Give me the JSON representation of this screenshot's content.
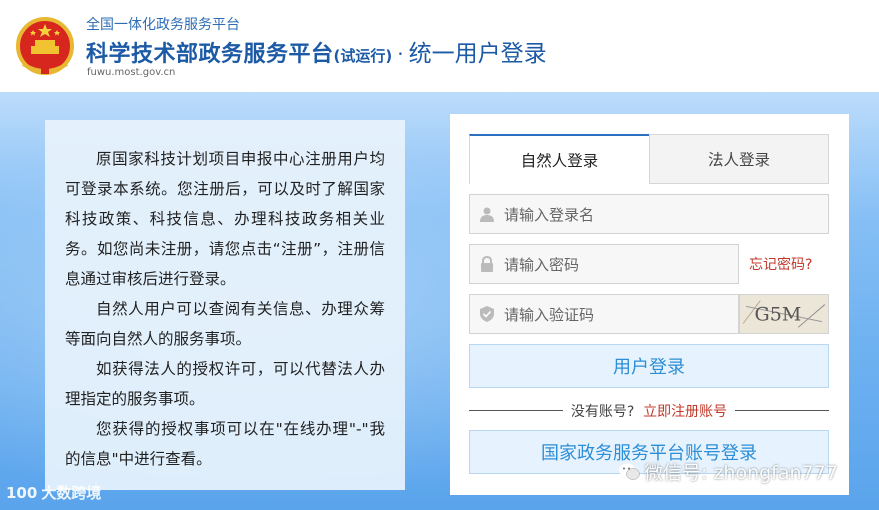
{
  "header": {
    "platform_sub": "全国一体化政务服务平台",
    "title_main": "科学技术部政务服务平台",
    "title_trial": "(试运行)",
    "title_dot": "·",
    "title_login": "统一用户登录",
    "domain": "fuwu.most.gov.cn"
  },
  "info": {
    "paragraphs": [
      "原国家科技计划项目申报中心注册用户均可登录本系统。您注册后，可以及时了解国家科技政策、科技信息、办理科技政务相关业务。如您尚未注册，请您点击“注册”，注册信息通过审核后进行登录。",
      "自然人用户可以查阅有关信息、办理众筹等面向自然人的服务事项。",
      "如获得法人的授权许可，可以代替法人办理指定的服务事项。",
      "您获得的授权事项可以在\"在线办理\"-\"我的信息\"中进行查看。"
    ]
  },
  "login": {
    "tabs": [
      "自然人登录",
      "法人登录"
    ],
    "username_placeholder": "请输入登录名",
    "password_placeholder": "请输入密码",
    "forgot_label": "忘记密码?",
    "captcha_placeholder": "请输入验证码",
    "captcha_text": "G5M",
    "login_button": "用户登录",
    "no_account": "没有账号?",
    "register_now": "立即注册账号",
    "gov_login_button": "国家政务服务平台账号登录"
  },
  "watermarks": {
    "left": "大数跨境",
    "left_badge": "100",
    "right": "微信号: zhongfan777"
  },
  "colors": {
    "title_blue": "#1c5aa6",
    "link_red": "#c0392b",
    "button_text": "#2c8ed6",
    "tab_accent": "#2b6fc0"
  }
}
